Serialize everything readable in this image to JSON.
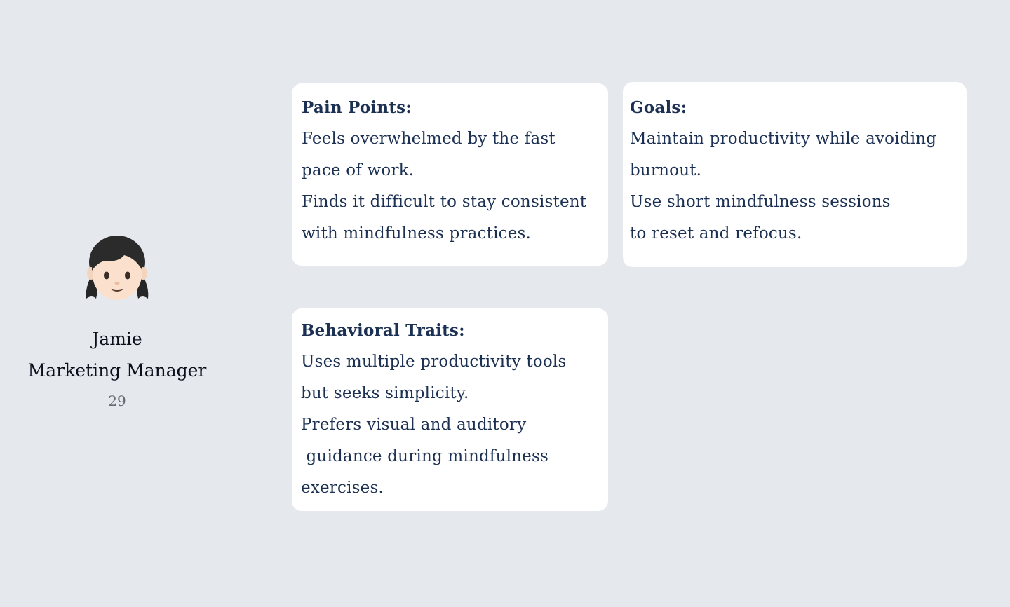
{
  "persona": {
    "avatar_icon": "girl-emoji-icon",
    "name": "Jamie",
    "role": "Marketing Manager",
    "age": "29"
  },
  "cards": {
    "pain_points": {
      "title": "Pain Points:",
      "lines": [
        "Feels overwhelmed by the fast",
        "pace of work.",
        "Finds it difficult to stay consistent",
        "with mindfulness practices."
      ]
    },
    "goals": {
      "title": "Goals:",
      "lines": [
        "Maintain productivity while avoiding",
        "burnout.",
        "Use short mindfulness sessions",
        "to reset and refocus."
      ]
    },
    "behavioral_traits": {
      "title": "Behavioral Traits:",
      "lines": [
        "Uses multiple productivity tools",
        "but seeks simplicity.",
        "Prefers visual and auditory",
        " guidance during mindfulness",
        "exercises."
      ]
    }
  },
  "colors": {
    "background": "#e5e8ed",
    "card": "#ffffff",
    "card_text": "#1b3052",
    "name_text": "#0b0f1a",
    "age_text": "#666a72"
  }
}
